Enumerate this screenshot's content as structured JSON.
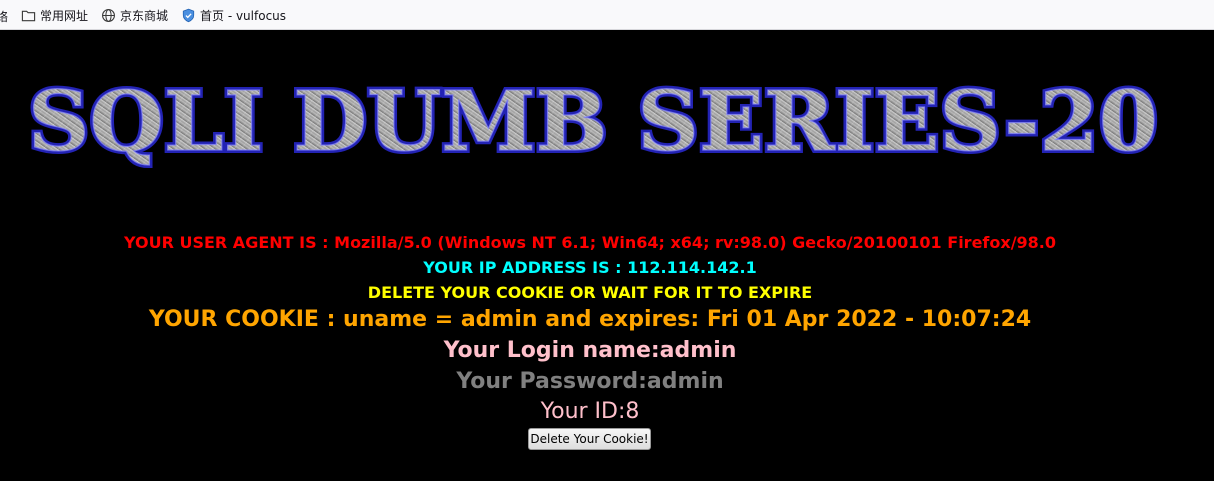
{
  "bookmarks_bar": {
    "truncated_left": "络",
    "items": [
      {
        "label": "常用网址",
        "icon": "folder-icon"
      },
      {
        "label": "京东商城",
        "icon": "globe-icon"
      },
      {
        "label": "首页 - vulfocus",
        "icon": "shield-icon"
      }
    ]
  },
  "page": {
    "banner_text": "SQLI DUMB SERIES-20",
    "user_agent": "YOUR USER AGENT IS : Mozilla/5.0 (Windows NT 6.1; Win64; x64; rv:98.0) Gecko/20100101 Firefox/98.0",
    "ip_address": "YOUR IP ADDRESS IS : 112.114.142.1",
    "delete_message": "DELETE YOUR COOKIE OR WAIT FOR IT TO EXPIRE",
    "cookie": "YOUR COOKIE : uname = admin and expires: Fri 01 Apr 2022 - 10:07:24",
    "login_name": "Your Login name:admin",
    "password": "Your Password:admin",
    "user_id": "Your ID:8",
    "delete_button": "Delete Your Cookie!"
  },
  "colors": {
    "background": "#000000",
    "user_agent": "#ff0000",
    "ip_address": "#00ffff",
    "delete_message": "#ffff00",
    "cookie": "#ffa500",
    "login_name": "#ffc0cb",
    "password": "#808080",
    "user_id": "#ffc0cb",
    "banner_outline": "#2323b4"
  }
}
